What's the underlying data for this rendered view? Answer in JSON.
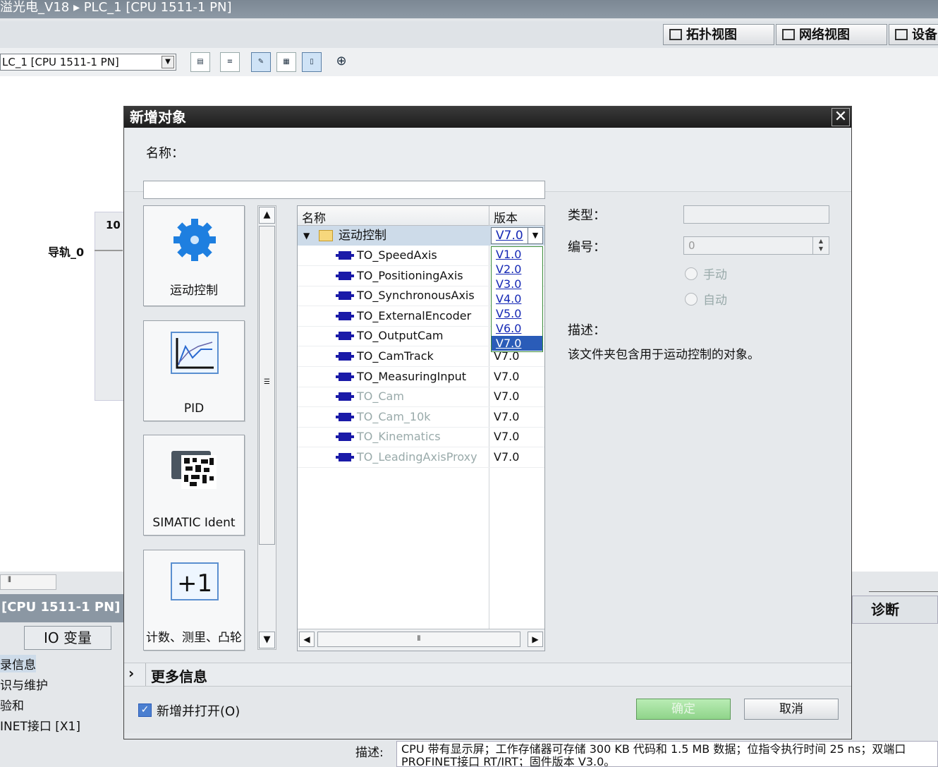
{
  "titlebar": {
    "text": "溢光电_V18  ▸  PLC_1 [CPU 1511-1 PN]"
  },
  "view_tabs": {
    "topology": "拓扑视图",
    "network": "网络视图",
    "device": "设备"
  },
  "toolbar": {
    "device_select": "LC_1 [CPU 1511-1 PN]"
  },
  "canvas": {
    "rail_label": "导轨_0",
    "rail_number": "10"
  },
  "bottom_left": {
    "cpu_header": "[CPU 1511-1 PN]",
    "io_tab": "IO 变量",
    "items": [
      "录信息",
      "识与维护",
      "验和",
      "INET接口 [X1]"
    ]
  },
  "diagnostics_tab": "诊断",
  "bottom_desc": {
    "label": "描述:",
    "text_line1": "CPU 带有显示屏；工作存储器可存储 300 KB 代码和 1.5 MB 数据；位指令执行时间 25 ns；双端口",
    "text_line2": "PROFINET接口 RT/IRT；固件版本 V3.0。"
  },
  "dialog": {
    "title": "新增对象",
    "close": "✕",
    "name_label": "名称：",
    "name_value": "",
    "categories": [
      {
        "label": "运动控制",
        "icon": "gear-icon"
      },
      {
        "label": "PID",
        "icon": "pid-chart-icon"
      },
      {
        "label": "SIMATIC Ident",
        "icon": "rfid-reader-icon"
      },
      {
        "label": "计数、测里、凸轮",
        "icon": "plus-one-icon"
      }
    ],
    "tree": {
      "col_name": "名称",
      "col_version": "版本",
      "folder": {
        "name": "运动控制",
        "version": "V7.0"
      },
      "version_options": [
        "V1.0",
        "V2.0",
        "V3.0",
        "V4.0",
        "V5.0",
        "V6.0",
        "V7.0"
      ],
      "selected_version": "V7.0",
      "rows": [
        {
          "name": "TO_SpeedAxis",
          "version": "",
          "disabled": false
        },
        {
          "name": "TO_PositioningAxis",
          "version": "",
          "disabled": false
        },
        {
          "name": "TO_SynchronousAxis",
          "version": "",
          "disabled": false
        },
        {
          "name": "TO_ExternalEncoder",
          "version": "",
          "disabled": false
        },
        {
          "name": "TO_OutputCam",
          "version": "",
          "disabled": false
        },
        {
          "name": "TO_CamTrack",
          "version": "V7.0",
          "disabled": false
        },
        {
          "name": "TO_MeasuringInput",
          "version": "V7.0",
          "disabled": false
        },
        {
          "name": "TO_Cam",
          "version": "V7.0",
          "disabled": true
        },
        {
          "name": "TO_Cam_10k",
          "version": "V7.0",
          "disabled": true
        },
        {
          "name": "TO_Kinematics",
          "version": "V7.0",
          "disabled": true
        },
        {
          "name": "TO_LeadingAxisProxy",
          "version": "V7.0",
          "disabled": true
        }
      ]
    },
    "props": {
      "type_label": "类型：",
      "type_value": "",
      "number_label": "编号：",
      "number_value": "0",
      "manual": "手动",
      "auto": "自动",
      "desc_label": "描述：",
      "desc_text": "该文件夹包含用于运动控制的对象。"
    },
    "more_info": "更多信息",
    "add_and_open": "新增并打开(O)",
    "add_and_open_checked": true,
    "ok": "确定",
    "cancel": "取消"
  }
}
